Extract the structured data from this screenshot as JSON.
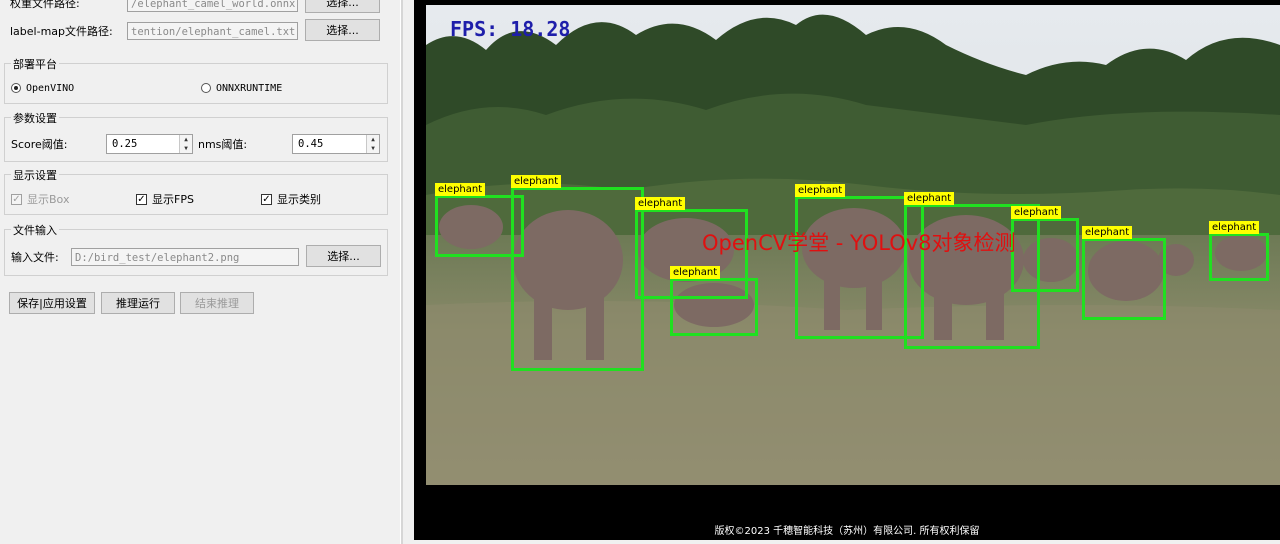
{
  "files": {
    "weights_label": "权重文件路径:",
    "weights_value": "/elephant_camel_world.onnx",
    "weights_button": "选择...",
    "labelmap_label": "label-map文件路径:",
    "labelmap_value": "tention/elephant_camel.txt",
    "labelmap_button": "选择..."
  },
  "platform": {
    "title": "部署平台",
    "options": [
      "OpenVINO",
      "ONNXRUNTIME"
    ],
    "selected": "OpenVINO"
  },
  "params": {
    "title": "参数设置",
    "score_label": "Score阈值:",
    "score_value": "0.25",
    "nms_label": "nms阈值:",
    "nms_value": "0.45"
  },
  "display": {
    "title": "显示设置",
    "box_label": "显示Box",
    "box_checked": true,
    "box_enabled": false,
    "fps_label": "显示FPS",
    "fps_checked": true,
    "class_label": "显示类别",
    "class_checked": true
  },
  "input": {
    "title": "文件输入",
    "file_label": "输入文件:",
    "file_value": "D:/bird_test/elephant2.png",
    "file_button": "选择..."
  },
  "actions": {
    "save": "保存|应用设置",
    "run": "推理运行",
    "stop": "结束推理"
  },
  "viewer": {
    "fps_text": "FPS: 18.28",
    "watermark": "OpenCV学堂 - YOLOv8对象检测",
    "copyright": "版权©2023 千穗智能科技（苏州）有限公司. 所有权利保留",
    "box_color": "#20e020",
    "label_bg_color": "#ffff00",
    "detections": [
      {
        "label": "elephant"
      },
      {
        "label": "elephant"
      },
      {
        "label": "elephant"
      },
      {
        "label": "elephant"
      },
      {
        "label": "elephant"
      },
      {
        "label": "elephant"
      },
      {
        "label": "elephant"
      },
      {
        "label": "elephant"
      },
      {
        "label": "elephant"
      }
    ]
  }
}
